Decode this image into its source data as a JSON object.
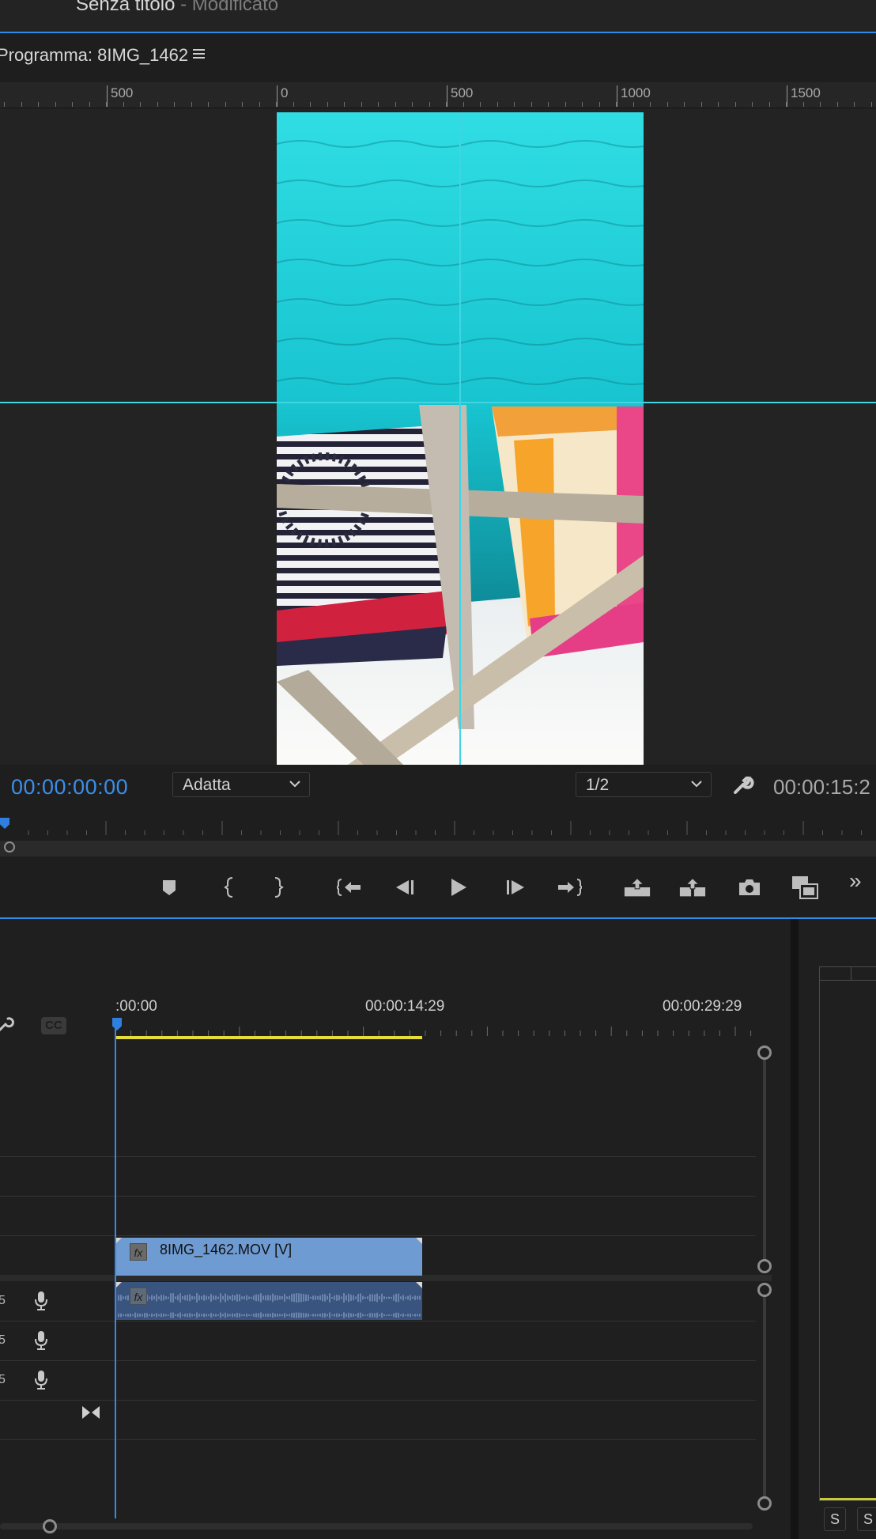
{
  "window": {
    "project_title": "Senza titolo",
    "project_status": "- Modificato"
  },
  "program_monitor": {
    "title": "Programma: 8IMG_1462",
    "ruler_labels": [
      "500",
      "0",
      "500",
      "1000",
      "1500"
    ],
    "current_timecode": "00:00:00:00",
    "zoom_dropdown": "Adatta",
    "resolution_dropdown": "1/2",
    "duration_timecode": "00:00:15:2",
    "transport_buttons": [
      {
        "name": "add-marker-button",
        "icon": "marker-icon"
      },
      {
        "name": "mark-in-button",
        "icon": "mark-in-icon"
      },
      {
        "name": "mark-out-button",
        "icon": "mark-out-icon"
      },
      {
        "name": "go-to-in-button",
        "icon": "go-to-in-icon"
      },
      {
        "name": "step-back-button",
        "icon": "step-back-icon"
      },
      {
        "name": "play-button",
        "icon": "play-icon"
      },
      {
        "name": "step-forward-button",
        "icon": "step-forward-icon"
      },
      {
        "name": "go-to-out-button",
        "icon": "go-to-out-icon"
      },
      {
        "name": "lift-button",
        "icon": "lift-icon"
      },
      {
        "name": "extract-button",
        "icon": "extract-icon"
      },
      {
        "name": "export-frame-button",
        "icon": "camera-icon"
      },
      {
        "name": "compare-view-button",
        "icon": "compare-view-icon"
      }
    ],
    "more_controls": "»"
  },
  "timeline": {
    "time_labels": [
      ":00:00",
      "00:00:14:29",
      "00:00:29:29"
    ],
    "cc_label": "CC",
    "video_clip": {
      "name": "8IMG_1462.MOV [V]",
      "fx": "fx"
    },
    "audio_clip": {
      "fx": "fx"
    },
    "audio_track_labels": [
      "5",
      "5",
      "5"
    ],
    "colors": {
      "playhead": "#3b87e6",
      "work_area": "#e6dd3a",
      "video_clip": "#6f9bd3",
      "audio_clip": "#3a5480",
      "guides": "#3fd5e3",
      "panel_focus": "#2d8ceb"
    }
  },
  "audio_meter": {
    "solo_buttons": [
      "S",
      "S"
    ]
  }
}
